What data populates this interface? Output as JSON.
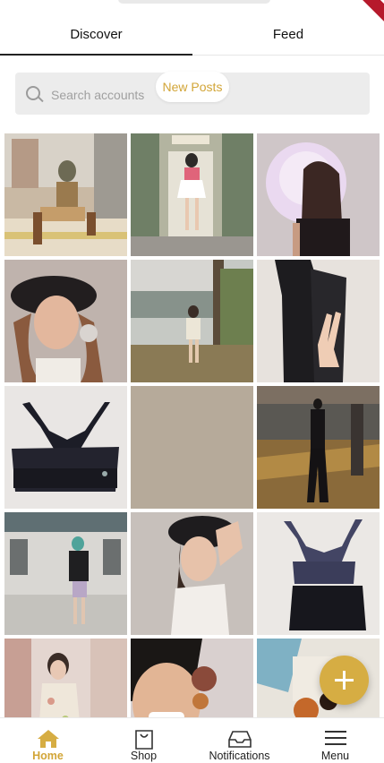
{
  "colors": {
    "accent": "#d6ad43",
    "active_label": "#d2a537"
  },
  "tabs": [
    {
      "label": "Discover",
      "active": true
    },
    {
      "label": "Feed",
      "active": false
    }
  ],
  "search": {
    "placeholder": "Search accounts",
    "value": ""
  },
  "new_posts": {
    "label": "New Posts"
  },
  "posts": [
    {
      "subject": "woman crouching on stairs outdoors"
    },
    {
      "subject": "woman standing in front of a doorway"
    },
    {
      "subject": "portrait with light projection"
    },
    {
      "subject": "woman in black beret"
    },
    {
      "subject": "woman in white outfit near tree"
    },
    {
      "subject": "black leggings with peace sign hand"
    },
    {
      "subject": "black sports bra flatlay"
    },
    {
      "subject": "plain beige image"
    },
    {
      "subject": "woman in black on road"
    },
    {
      "subject": "woman in front of storefront"
    },
    {
      "subject": "woman in beret with white top"
    },
    {
      "subject": "navy sports bra and shorts flatlay"
    },
    {
      "subject": "woman in floral dress"
    },
    {
      "subject": "smiling woman selfie"
    },
    {
      "subject": "magazine and orange objects"
    }
  ],
  "fab": {
    "icon": "plus-icon"
  },
  "nav": [
    {
      "label": "Home",
      "icon": "home-icon",
      "active": true
    },
    {
      "label": "Shop",
      "icon": "shopping-bag-icon",
      "active": false
    },
    {
      "label": "Notifications",
      "icon": "inbox-icon",
      "active": false
    },
    {
      "label": "Menu",
      "icon": "menu-icon",
      "active": false
    }
  ]
}
